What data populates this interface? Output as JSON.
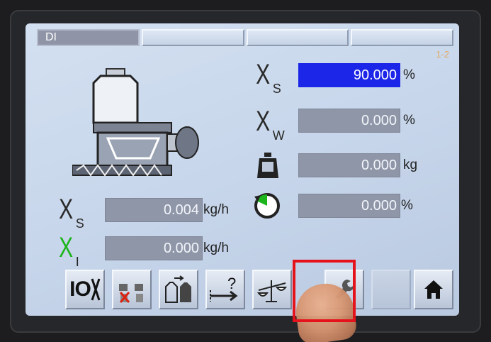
{
  "tabs": [
    {
      "label": "DI",
      "active": true
    },
    {
      "label": "",
      "active": false
    },
    {
      "label": "",
      "active": false
    },
    {
      "label": ""
    }
  ],
  "page_indicator": "1-2",
  "readings": {
    "xs_setpoint": {
      "symbol": "X",
      "sub": "S",
      "value": "90.000",
      "unit": "%"
    },
    "xw": {
      "symbol": "X",
      "sub": "W",
      "value": "0.000",
      "unit": "%"
    },
    "weight": {
      "value": "0.000",
      "unit": "kg"
    },
    "motor": {
      "value": "0.000",
      "unit": "%"
    },
    "xs_flow": {
      "symbol": "X",
      "sub": "S",
      "value": "0.004",
      "unit": "kg/h"
    },
    "xi_flow": {
      "symbol": "X",
      "sub": "I",
      "value": "0.000",
      "unit": "kg/h"
    }
  },
  "toolbar": {
    "io_label": "IO",
    "buttons": [
      "io-toggle-icon",
      "refill-disabled-icon",
      "refill-exchange-icon",
      "query-arrow-icon",
      "balance-scale-icon",
      "wrench-service-icon",
      "blank",
      "home-icon"
    ]
  },
  "colors": {
    "selected_field": "#1b26e8",
    "field": "#8f96a8",
    "green_symbol": "#1bb41b",
    "highlight": "#e5121b"
  }
}
